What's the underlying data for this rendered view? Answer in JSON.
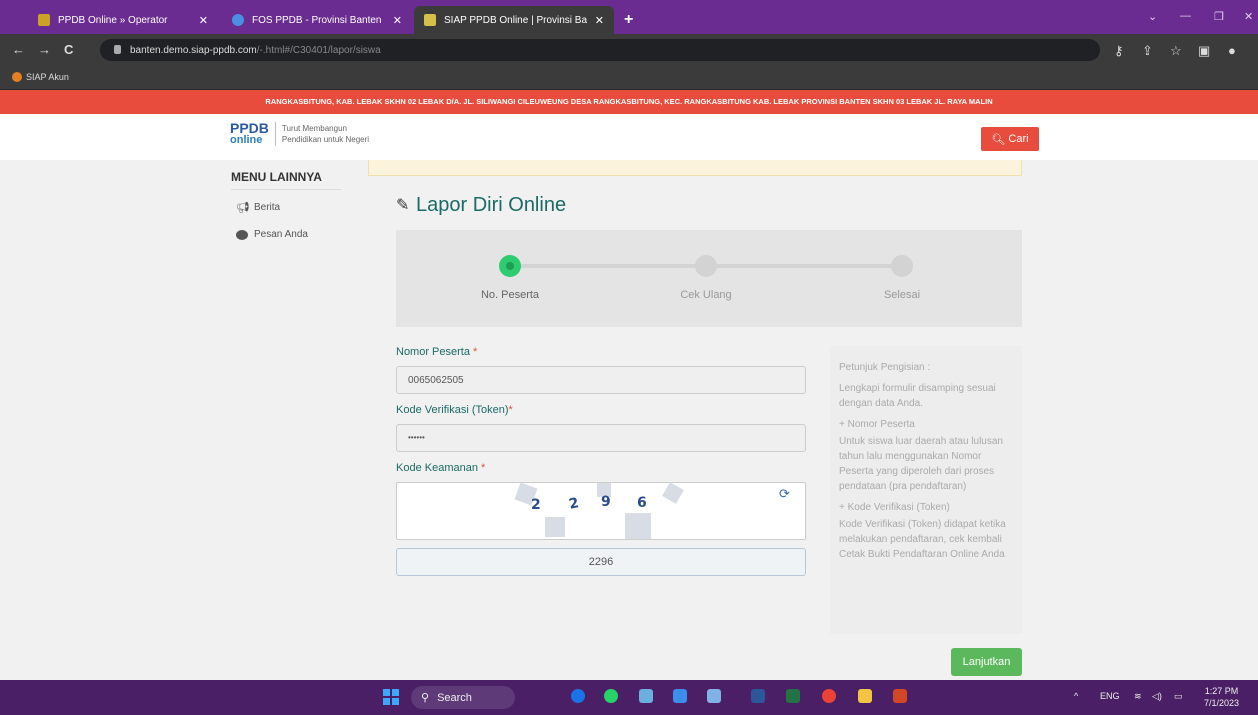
{
  "browser": {
    "tabs": [
      {
        "title": "PPDB Online » Operator",
        "active": false,
        "favicon_color": "#c9a227"
      },
      {
        "title": "FOS PPDB - Provinsi Banten",
        "active": false,
        "favicon_color": "#4a90e2"
      },
      {
        "title": "SIAP PPDB Online | Provinsi Bant",
        "active": true,
        "favicon_color": "#d4c04a"
      }
    ],
    "url_host": "banten.demo.siap-ppdb.com",
    "url_path": "/-.html#/C30401/lapor/siswa",
    "bookmark": "SIAP Akun"
  },
  "site": {
    "announcement": "RANGKASBITUNG, KAB. LEBAK SKHN 02 LEBAK D/A. JL. SILIWANGI CILEUWEUNG DESA RANGKASBITUNG, KEC. RANGKASBITUNG KAB. LEBAK PROVINSI BANTEN SKHN 03 LEBAK JL. RAYA MALIN",
    "logo_top": "PPDB",
    "logo_bottom": "online",
    "tagline_1": "Turut Membangun",
    "tagline_2": "Pendidikan untuk Negeri",
    "search_label": "Cari"
  },
  "sidebar": {
    "title": "MENU LAINNYA",
    "items": [
      {
        "label": "Berita"
      },
      {
        "label": "Pesan Anda"
      }
    ]
  },
  "main": {
    "title": "Lapor Diri Online",
    "steps": [
      {
        "label": "No. Peserta",
        "active": true
      },
      {
        "label": "Cek Ulang",
        "active": false
      },
      {
        "label": "Selesai",
        "active": false
      }
    ],
    "progress": 0,
    "fields": {
      "nomor_label": "Nomor Peserta",
      "nomor_value": "0065062505",
      "token_label": "Kode Verifikasi (Token)",
      "token_value": "••••••",
      "keamanan_label": "Kode Keamanan",
      "captcha_chars": [
        "2",
        "2",
        "9",
        "6"
      ],
      "captcha_value": "2296"
    },
    "hint": {
      "title": "Petunjuk Pengisian :",
      "intro": "Lengkapi formulir disamping sesuai dengan data Anda.",
      "h1": "+ Nomor Peserta",
      "p1": "Untuk siswa luar daerah atau lulusan tahun lalu menggunakan Nomor Peserta yang diperoleh dari proses pendataan (pra pendaftaran)",
      "h2": "+ Kode Verifikasi (Token)",
      "p2": "Kode Verifikasi (Token) didapat ketika melakukan pendaftaran, cek kembali Cetak Bukti Pendaftaran Online Anda"
    },
    "next_label": "Lanjutkan"
  },
  "taskbar": {
    "search": "Search",
    "lang": "ENG",
    "time": "1:27 PM",
    "date": "7/1/2023"
  }
}
